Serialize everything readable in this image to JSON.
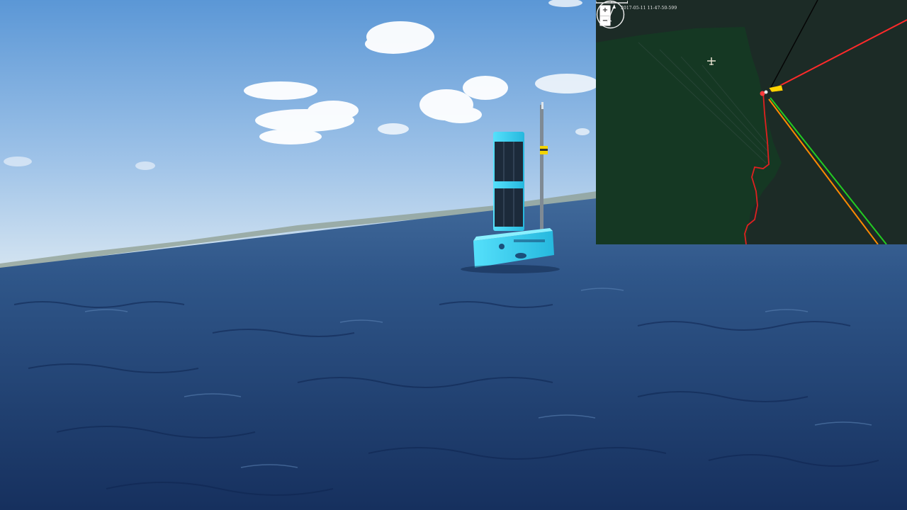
{
  "scene": {
    "colors": {
      "sky_top": "#5f9bd8",
      "sky_horizon": "#c9dcee",
      "sea_far": "#3f6d9f",
      "sea_near": "#1b3a6c",
      "buoy_hull": "#3fd3f2",
      "solar_panel": "#1c2a3a"
    }
  },
  "map": {
    "timestamp": "2017-05-11 11-47-50-599",
    "zoom_in_label": "+",
    "zoom_out_label": "−",
    "compass_icon": "north-arrow-icon",
    "colors": {
      "land": "#153823",
      "water": "#1c2b26",
      "track": "#e02020",
      "heading_line": "#ff2a2a",
      "course_line_green": "#22cc22",
      "course_line_orange": "#ff8a00",
      "vessel": "#ffd400"
    }
  }
}
